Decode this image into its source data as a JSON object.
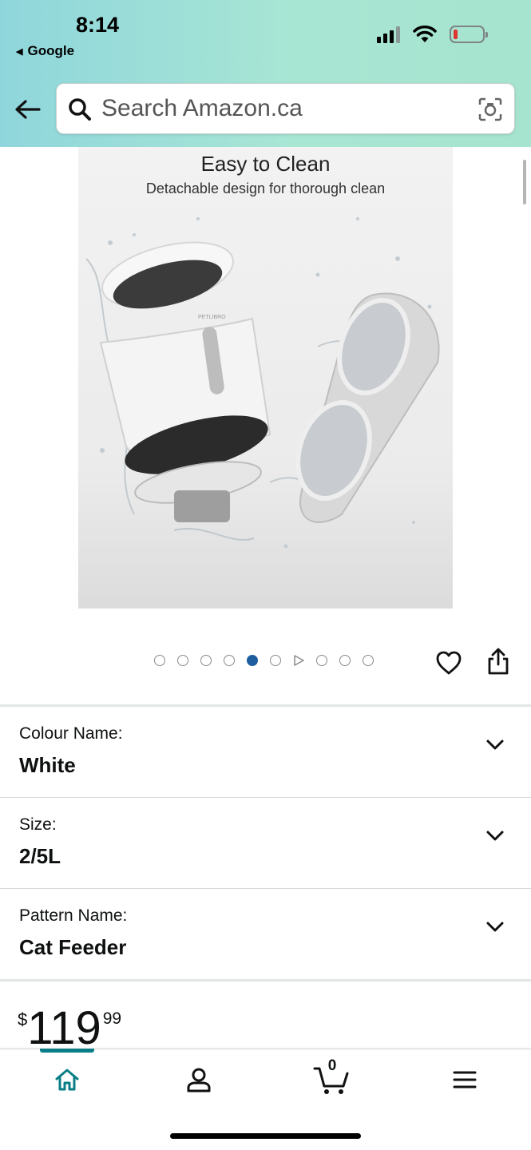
{
  "status_bar": {
    "time": "8:14",
    "back_app": "Google"
  },
  "search": {
    "placeholder": "Search Amazon.ca"
  },
  "product_image": {
    "title": "Easy to Clean",
    "subtitle": "Detachable design for thorough clean",
    "brand_mark": "PETLIBRO"
  },
  "carousel": {
    "total_items": 10,
    "active_index": 4,
    "video_index": 5
  },
  "options": [
    {
      "label": "Colour Name:",
      "value": "White"
    },
    {
      "label": "Size:",
      "value": "2/5L"
    },
    {
      "label": "Pattern Name:",
      "value": "Cat Feeder"
    }
  ],
  "price": {
    "symbol": "$",
    "whole": "119",
    "fraction": "99"
  },
  "tabbar": {
    "cart_count": "0",
    "active_tab": "home",
    "accent_color": "#0a7e86"
  },
  "colors": {
    "header_gradient_start": "#8fd6dc",
    "header_gradient_end": "#a6e4cf",
    "active_dot": "#1f5e9e"
  }
}
